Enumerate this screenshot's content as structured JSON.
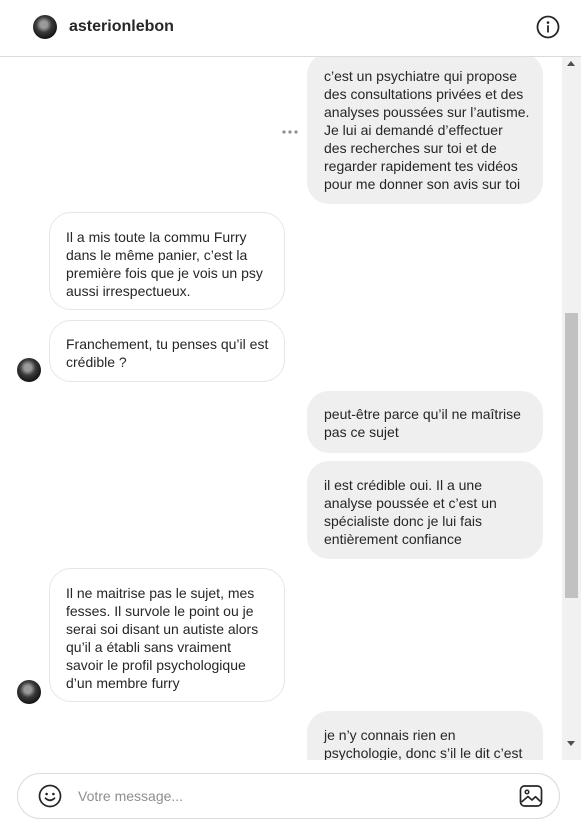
{
  "header": {
    "username": "asterionlebon",
    "info_icon": "info-icon"
  },
  "messages": [
    {
      "direction": "sent",
      "lines": [
        "c’est un psychiatre qui propose",
        "des consultations privées et des",
        "analyses poussées sur l’autisme.",
        "Je lui ai demandé d’effectuer",
        "des recherches sur toi et de",
        "regarder rapidement tes vidéos",
        "pour me donner son avis sur toi"
      ]
    },
    {
      "direction": "received",
      "lines": [
        "Il a mis toute la commu Furry",
        "dans le même panier, c’est la",
        "première fois que je vois un psy",
        "aussi irrespectueux."
      ]
    },
    {
      "direction": "received",
      "lines": [
        "Franchement, tu penses qu’il est",
        "crédible ?"
      ]
    },
    {
      "direction": "sent",
      "lines": [
        "peut-être parce qu’il ne maîtrise",
        "pas ce sujet"
      ]
    },
    {
      "direction": "sent",
      "lines": [
        "il est crédible oui. Il a une",
        "analyse poussée et c’est un",
        "spécialiste donc je lui fais",
        "entièrement confiance"
      ]
    },
    {
      "direction": "received",
      "lines": [
        "Il ne maitrise pas le sujet, mes",
        "fesses. Il survole le point ou je",
        "serai soi disant un autiste alors",
        "qu’il a établi sans vraiment",
        "savoir le profil psychologique",
        "d’un membre furry"
      ]
    },
    {
      "direction": "sent",
      "lines": [
        "je n’y connais rien en",
        "psychologie, donc s’il le dit c’est"
      ]
    }
  ],
  "composer": {
    "placeholder": "Votre message...",
    "value": "",
    "emoji_icon": "smiley-icon",
    "image_icon": "image-icon"
  },
  "colors": {
    "sent_bubble": "#efefef",
    "received_border": "#e6e6e6",
    "text": "#262626",
    "divider": "#dbdbdb"
  }
}
